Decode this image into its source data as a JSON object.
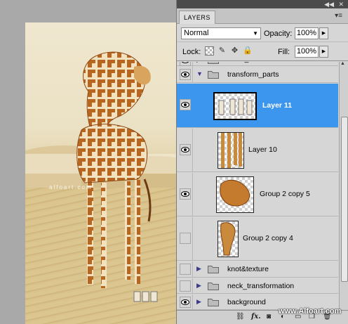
{
  "canvas": {
    "watermark_text": "alfoart.com"
  },
  "panel": {
    "tab_label": "LAYERS",
    "blend_mode": "Normal",
    "opacity_label": "Opacity:",
    "opacity_value": "100%",
    "lock_label": "Lock:",
    "fill_label": "Fill:",
    "fill_value": "100%"
  },
  "layers": [
    {
      "name": "small_shadows",
      "type": "group",
      "visible": true,
      "expanded": false
    },
    {
      "name": "transform_parts",
      "type": "group",
      "visible": true,
      "expanded": true
    },
    {
      "name": "Layer 11",
      "type": "layer",
      "visible": true,
      "selected": true
    },
    {
      "name": "Layer 10",
      "type": "layer",
      "visible": true
    },
    {
      "name": "Group 2 copy 5",
      "type": "layer",
      "visible": true
    },
    {
      "name": "Group 2 copy 4",
      "type": "layer",
      "visible": false
    },
    {
      "name": "knot&texture",
      "type": "group",
      "visible": false,
      "expanded": false
    },
    {
      "name": "neck_transformation",
      "type": "group",
      "visible": false,
      "expanded": false
    },
    {
      "name": "background",
      "type": "group",
      "visible": true,
      "expanded": false
    }
  ],
  "watermark": "www.Alfoart.com",
  "colors": {
    "selection": "#3d96ed",
    "panel_bg": "#d6d6d6",
    "header_bg": "#4b4b4b"
  }
}
